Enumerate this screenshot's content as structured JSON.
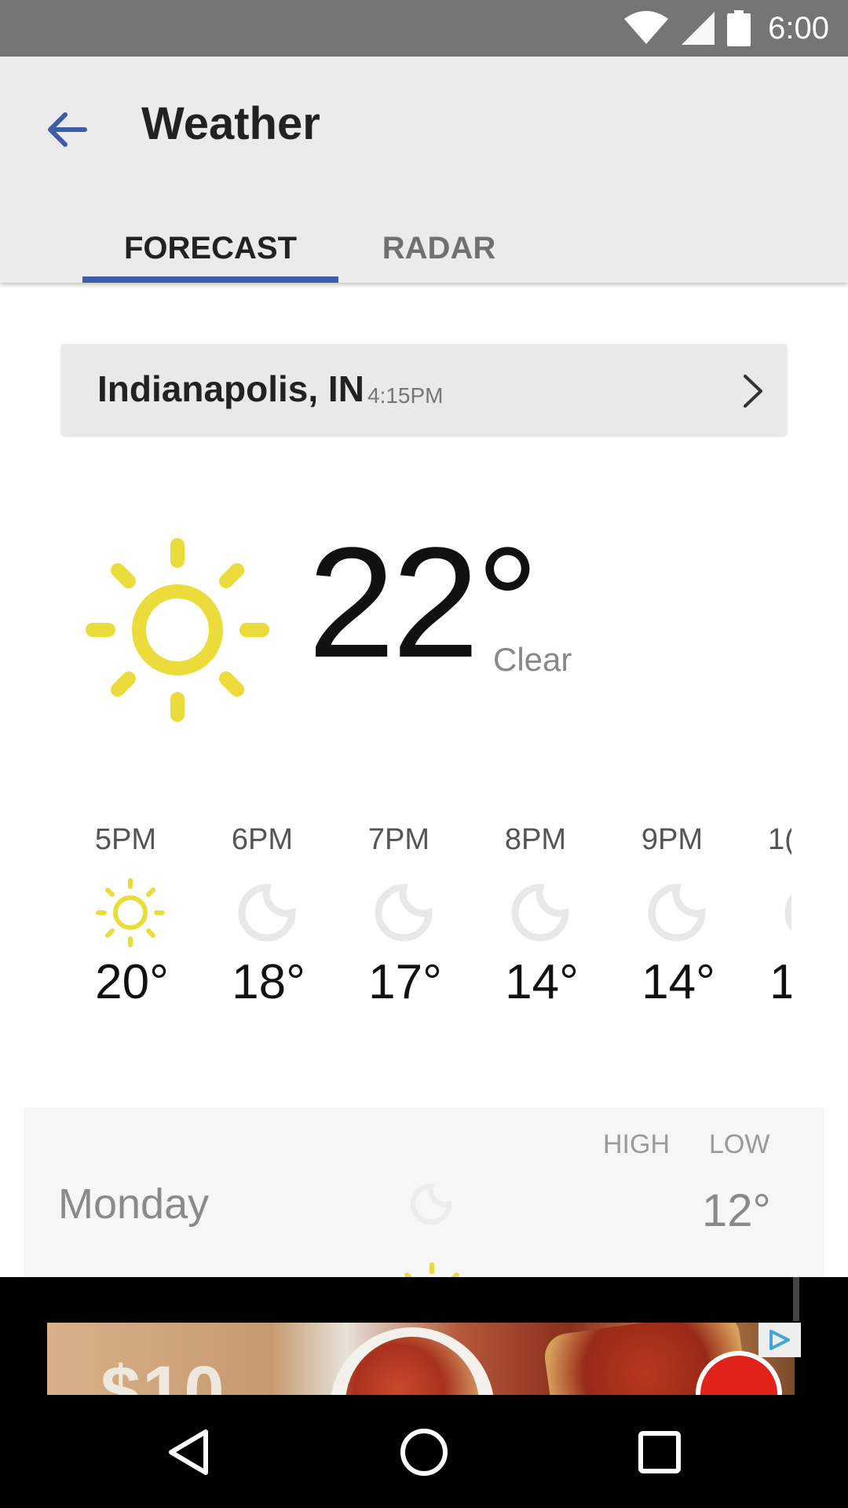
{
  "status_bar": {
    "time": "6:00"
  },
  "app_bar": {
    "title": "Weather"
  },
  "tabs": [
    {
      "label": "FORECAST",
      "selected": true
    },
    {
      "label": "RADAR",
      "selected": false
    }
  ],
  "location": {
    "name": "Indianapolis, IN",
    "time": "4:15PM"
  },
  "current": {
    "temperature": "22°",
    "condition": "Clear",
    "icon": "sun-icon"
  },
  "hourly": [
    {
      "time": "5PM",
      "icon": "sun-icon",
      "temp": "20°"
    },
    {
      "time": "6PM",
      "icon": "moon-icon",
      "temp": "18°"
    },
    {
      "time": "7PM",
      "icon": "moon-icon",
      "temp": "17°"
    },
    {
      "time": "8PM",
      "icon": "moon-icon",
      "temp": "14°"
    },
    {
      "time": "9PM",
      "icon": "moon-icon",
      "temp": "14°"
    },
    {
      "time": "1(",
      "icon": "moon-icon",
      "temp": "1"
    }
  ],
  "daily": {
    "high_label": "HIGH",
    "low_label": "LOW",
    "days": [
      {
        "day": "Monday",
        "icon": "moon-icon",
        "high": "",
        "low": "12°"
      }
    ]
  },
  "ad": {
    "price_text": "$10"
  },
  "colors": {
    "accent": "#3d5da8",
    "sun": "#ebdc3c",
    "statusbar": "#757575",
    "appbar": "#ebebeb"
  }
}
